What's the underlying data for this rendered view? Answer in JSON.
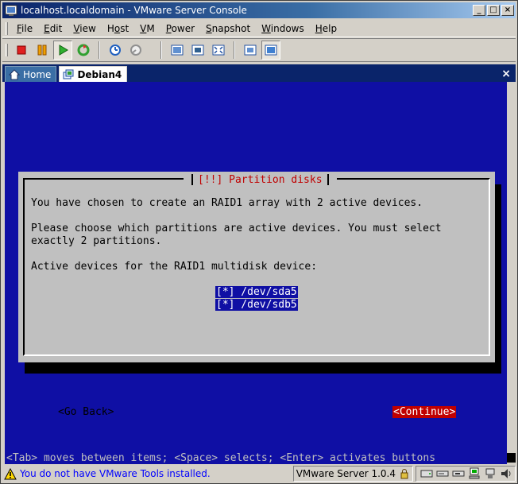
{
  "window": {
    "title": "localhost.localdomain - VMware Server Console"
  },
  "menubar": {
    "items": [
      {
        "label": "File",
        "key": "F",
        "rest": "ile"
      },
      {
        "label": "Edit",
        "key": "E",
        "rest": "dit"
      },
      {
        "label": "View",
        "key": "V",
        "rest": "iew"
      },
      {
        "label": "Host",
        "key": "H",
        "pre": "",
        "rest": "ost",
        "mid": "o"
      },
      {
        "label": "VM",
        "key": "V",
        "rest": "M"
      },
      {
        "label": "Power",
        "key": "P",
        "rest": "ower"
      },
      {
        "label": "Snapshot",
        "key": "S",
        "rest": "napshot"
      },
      {
        "label": "Windows",
        "key": "W",
        "rest": "indows"
      },
      {
        "label": "Help",
        "key": "H",
        "rest": "elp"
      }
    ]
  },
  "toolbar": {
    "icons": [
      "stop-icon",
      "pause-icon",
      "play-icon",
      "reset-icon",
      "snapshot-take-icon",
      "snapshot-revert-icon",
      "full-screen-icon",
      "quick-switch-icon",
      "fit-window-icon",
      "summary-icon",
      "console-view-icon"
    ]
  },
  "tabs": {
    "home_label": "Home",
    "vm_label": "Debian4",
    "close_label": "×"
  },
  "dialog": {
    "title": "[!!] Partition disks",
    "line1": "You have chosen to create an RAID1 array with 2 active devices.",
    "line2": "Please choose which partitions are active devices. You must select",
    "line3": "exactly 2 partitions.",
    "line4": "Active devices for the RAID1 multidisk device:",
    "options": [
      {
        "label": "[*] /dev/sda5"
      },
      {
        "label": "[*] /dev/sdb5"
      }
    ],
    "back_label": "<Go Back>",
    "continue_label": "<Continue>"
  },
  "console": {
    "help_text": "<Tab> moves between items; <Space> selects; <Enter> activates buttons"
  },
  "status": {
    "message": "You do not have VMware Tools installed.",
    "version": "VMware Server 1.0.4"
  },
  "colors": {
    "console_bg": "#0f0fa4",
    "dialog_bg": "#c0c0c0",
    "title_red": "#c00000",
    "status_link": "#0000ff"
  }
}
